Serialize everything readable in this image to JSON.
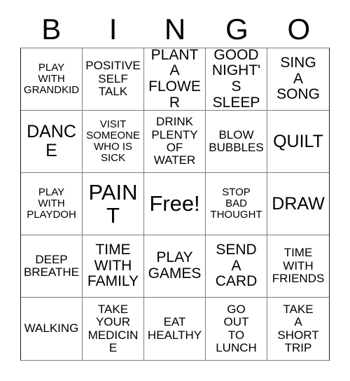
{
  "header": {
    "letters": [
      "B",
      "I",
      "N",
      "G",
      "O"
    ]
  },
  "grid": {
    "rows": [
      [
        {
          "text": "PLAY\nWITH\nGRANDKID",
          "size": "fs-xs",
          "free": false
        },
        {
          "text": "POSITIVE\nSELF\nTALK",
          "size": "fs-sm",
          "free": false
        },
        {
          "text": "PLANT A\nFLOWER",
          "size": "fs-md",
          "free": false
        },
        {
          "text": "GOOD\nNIGHT'S\nSLEEP",
          "size": "fs-md",
          "free": false
        },
        {
          "text": "SING\nA\nSONG",
          "size": "fs-md",
          "free": false
        }
      ],
      [
        {
          "text": "DANCE",
          "size": "fs-lg",
          "free": false
        },
        {
          "text": "VISIT\nSOMEONE\nWHO IS\nSICK",
          "size": "fs-xs",
          "free": false
        },
        {
          "text": "DRINK\nPLENTY\nOF\nWATER",
          "size": "fs-sm",
          "free": false
        },
        {
          "text": "BLOW\nBUBBLES",
          "size": "fs-sm",
          "free": false
        },
        {
          "text": "QUILT",
          "size": "fs-lg",
          "free": false
        }
      ],
      [
        {
          "text": "PLAY\nWITH\nPLAYDOH",
          "size": "fs-xs",
          "free": false
        },
        {
          "text": "PAINT",
          "size": "fs-xl",
          "free": false
        },
        {
          "text": "Free!",
          "size": "fs-xl",
          "free": true
        },
        {
          "text": "STOP\nBAD\nTHOUGHT",
          "size": "fs-xs",
          "free": false
        },
        {
          "text": "DRAW",
          "size": "fs-lg",
          "free": false
        }
      ],
      [
        {
          "text": "DEEP\nBREATHE",
          "size": "fs-sm",
          "free": false
        },
        {
          "text": "TIME\nWITH\nFAMILY",
          "size": "fs-md",
          "free": false
        },
        {
          "text": "PLAY\nGAMES",
          "size": "fs-md",
          "free": false
        },
        {
          "text": "SEND\nA\nCARD",
          "size": "fs-md",
          "free": false
        },
        {
          "text": "TIME\nWITH\nFRIENDS",
          "size": "fs-sm",
          "free": false
        }
      ],
      [
        {
          "text": "WALKING",
          "size": "fs-sm",
          "free": false
        },
        {
          "text": "TAKE\nYOUR\nMEDICINE",
          "size": "fs-sm",
          "free": false
        },
        {
          "text": "EAT\nHEALTHY",
          "size": "fs-sm",
          "free": false
        },
        {
          "text": "GO\nOUT\nTO\nLUNCH",
          "size": "fs-sm",
          "free": false
        },
        {
          "text": "TAKE\nA\nSHORT\nTRIP",
          "size": "fs-sm",
          "free": false
        }
      ]
    ]
  },
  "colors": {
    "background": "#ffffff",
    "text": "#000000",
    "grid_line": "#7d7d7d",
    "grid_outer": "#1a1a1a"
  }
}
